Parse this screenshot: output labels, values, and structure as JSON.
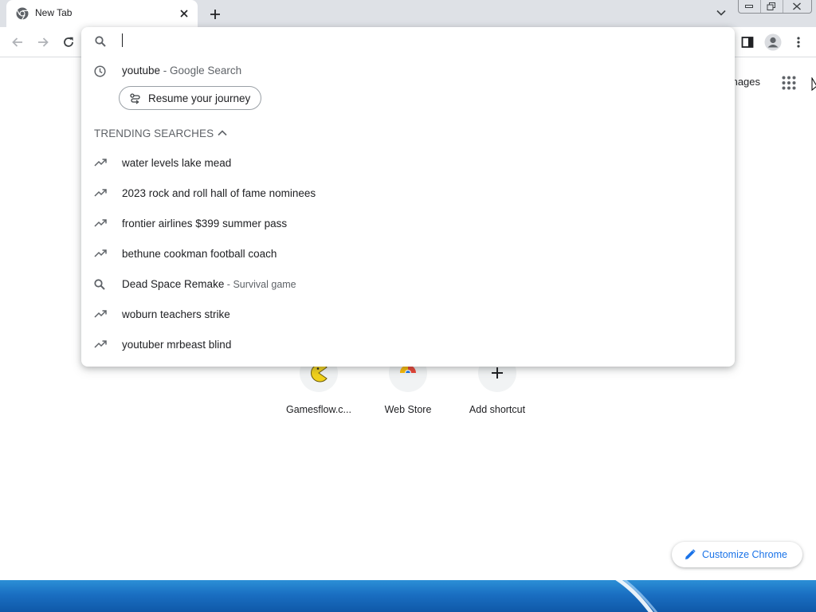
{
  "browser": {
    "tab": {
      "title": "New Tab",
      "favicon_icon": "chrome-icon",
      "close_icon": "close-icon"
    },
    "new_tab_icon": "plus-icon",
    "tab_search_icon": "chevron-down-icon",
    "window_controls": [
      "minimize-icon",
      "restore-icon",
      "close-icon"
    ],
    "toolbar": {
      "back_icon": "arrow-left-icon",
      "forward_icon": "arrow-right-icon",
      "reload_icon": "reload-icon",
      "side_panel_icon": "side-panel-icon",
      "profile_icon": "profile-icon",
      "menu_icon": "more-vert-icon"
    }
  },
  "omnibox": {
    "input_value": "",
    "search_icon": "search-icon",
    "history_suggestion": {
      "query": "youtube",
      "separator": " - ",
      "description": "Google Search",
      "icon": "history-icon"
    },
    "journey_chip": {
      "label": "Resume your journey",
      "icon": "journey-icon"
    },
    "trending": {
      "header": "TRENDING SEARCHES",
      "toggle_icon": "chevron-up-icon",
      "items": [
        {
          "text": "water levels lake mead",
          "description": "",
          "icon": "trending-icon"
        },
        {
          "text": "2023 rock and roll hall of fame nominees",
          "description": "",
          "icon": "trending-icon"
        },
        {
          "text": "frontier airlines $399 summer pass",
          "description": "",
          "icon": "trending-icon"
        },
        {
          "text": "bethune cookman football coach",
          "description": "",
          "icon": "trending-icon"
        },
        {
          "text": "Dead Space Remake",
          "description": "Survival game",
          "icon": "search-icon"
        },
        {
          "text": "woburn teachers strike",
          "description": "",
          "icon": "trending-icon"
        },
        {
          "text": "youtuber mrbeast blind",
          "description": "",
          "icon": "trending-icon"
        }
      ]
    }
  },
  "ntp": {
    "images_link": "mages",
    "apps_icon": "apps-grid-icon",
    "shortcuts": [
      {
        "label": "Gamesflow.c...",
        "icon": "pacman-icon"
      },
      {
        "label": "Web Store",
        "icon": "chrome-webstore-icon"
      },
      {
        "label": "Add shortcut",
        "icon": "plus-icon"
      }
    ],
    "customize": {
      "label": "Customize Chrome",
      "icon": "pencil-icon"
    }
  },
  "colors": {
    "accent": "#1a73e8",
    "tab_strip": "#dee1e6",
    "secondary_text": "#5f6368",
    "taskbar": "#1a6fc2"
  }
}
